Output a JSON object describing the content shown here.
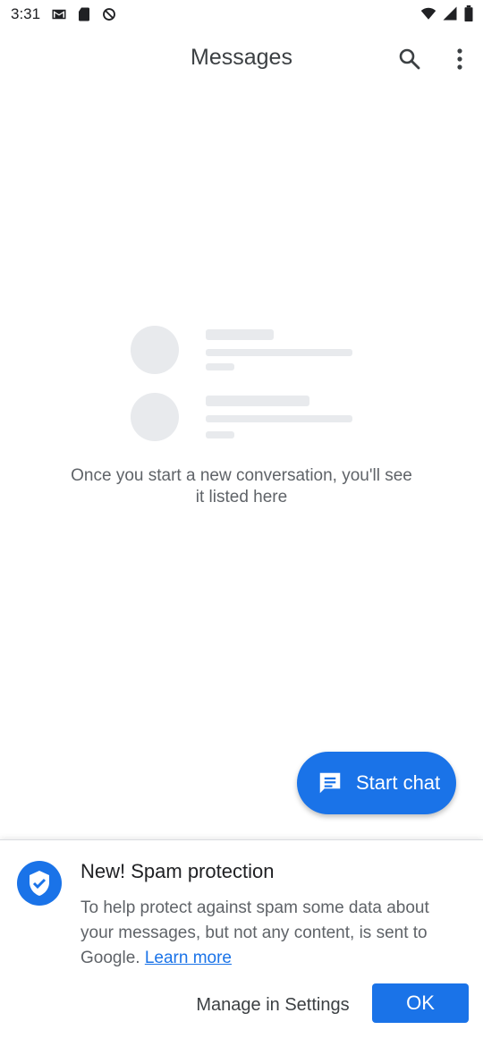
{
  "status_bar": {
    "time": "3:31",
    "icons_left": [
      "gmail-icon",
      "sd-card-icon",
      "no-sim-icon"
    ],
    "icons_right": [
      "wifi-icon",
      "signal-icon",
      "battery-icon"
    ]
  },
  "app_bar": {
    "title": "Messages",
    "search_icon": "search-icon",
    "more_icon": "more-vert-icon"
  },
  "empty_state": {
    "text_line1": "Once you start a new conversation, you'll see",
    "text_line2": "it listed here"
  },
  "fab": {
    "label": "Start chat",
    "icon": "chat-icon"
  },
  "spam_sheet": {
    "title": "New! Spam protection",
    "body": "To help protect against spam some data about your messages, but not any content, is sent to Google.",
    "learn_more": "Learn more",
    "manage_label": "Manage in Settings",
    "ok_label": "OK",
    "icon": "shield-check-icon"
  },
  "colors": {
    "accent": "#1a73e8",
    "text_primary": "#202124",
    "text_secondary": "#5f6368",
    "placeholder": "#e8eaed"
  }
}
